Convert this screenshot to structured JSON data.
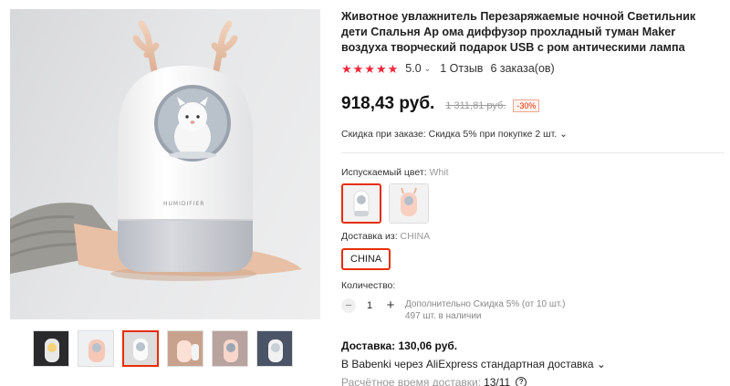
{
  "product": {
    "title": "Животное увлажнитель Перезаряжаемые ночной Светильник дети Спальня Ар ома диффузор прохладный туман Maker воздуха творческий подарок USB с ром антическими лампа",
    "rating_value": "5.0",
    "stars": 5,
    "reviews": "1 Отзыв",
    "orders": "6 заказа(ов)",
    "image_label": "HUMIDIFIER"
  },
  "price": {
    "current": "918,43 руб.",
    "old": "1 311,81 руб.",
    "discount": "-30%"
  },
  "order_discount": "Скидка при заказе: Скидка 5% при покупке 2 шт.",
  "color": {
    "label": "Испускаемый цвет:",
    "value": "Whit",
    "swatches": [
      "white-bear",
      "pink-deer"
    ]
  },
  "shipping_from": {
    "label": "Доставка из:",
    "value": "CHINA",
    "option": "CHINA"
  },
  "quantity": {
    "label": "Количество:",
    "value": "1",
    "extra_discount": "Дополнительно Скидка 5% (от 10 шт.)",
    "stock": "497 шт. в наличии"
  },
  "delivery": {
    "price": "Доставка: 130,06 руб.",
    "via": "В Babenki через AliExpress стандартная доставка",
    "time_label": "Расчётное время доставки:",
    "time_value": "13/11"
  },
  "colors": {
    "accent": "#e62e04",
    "star": "#f2273a"
  }
}
